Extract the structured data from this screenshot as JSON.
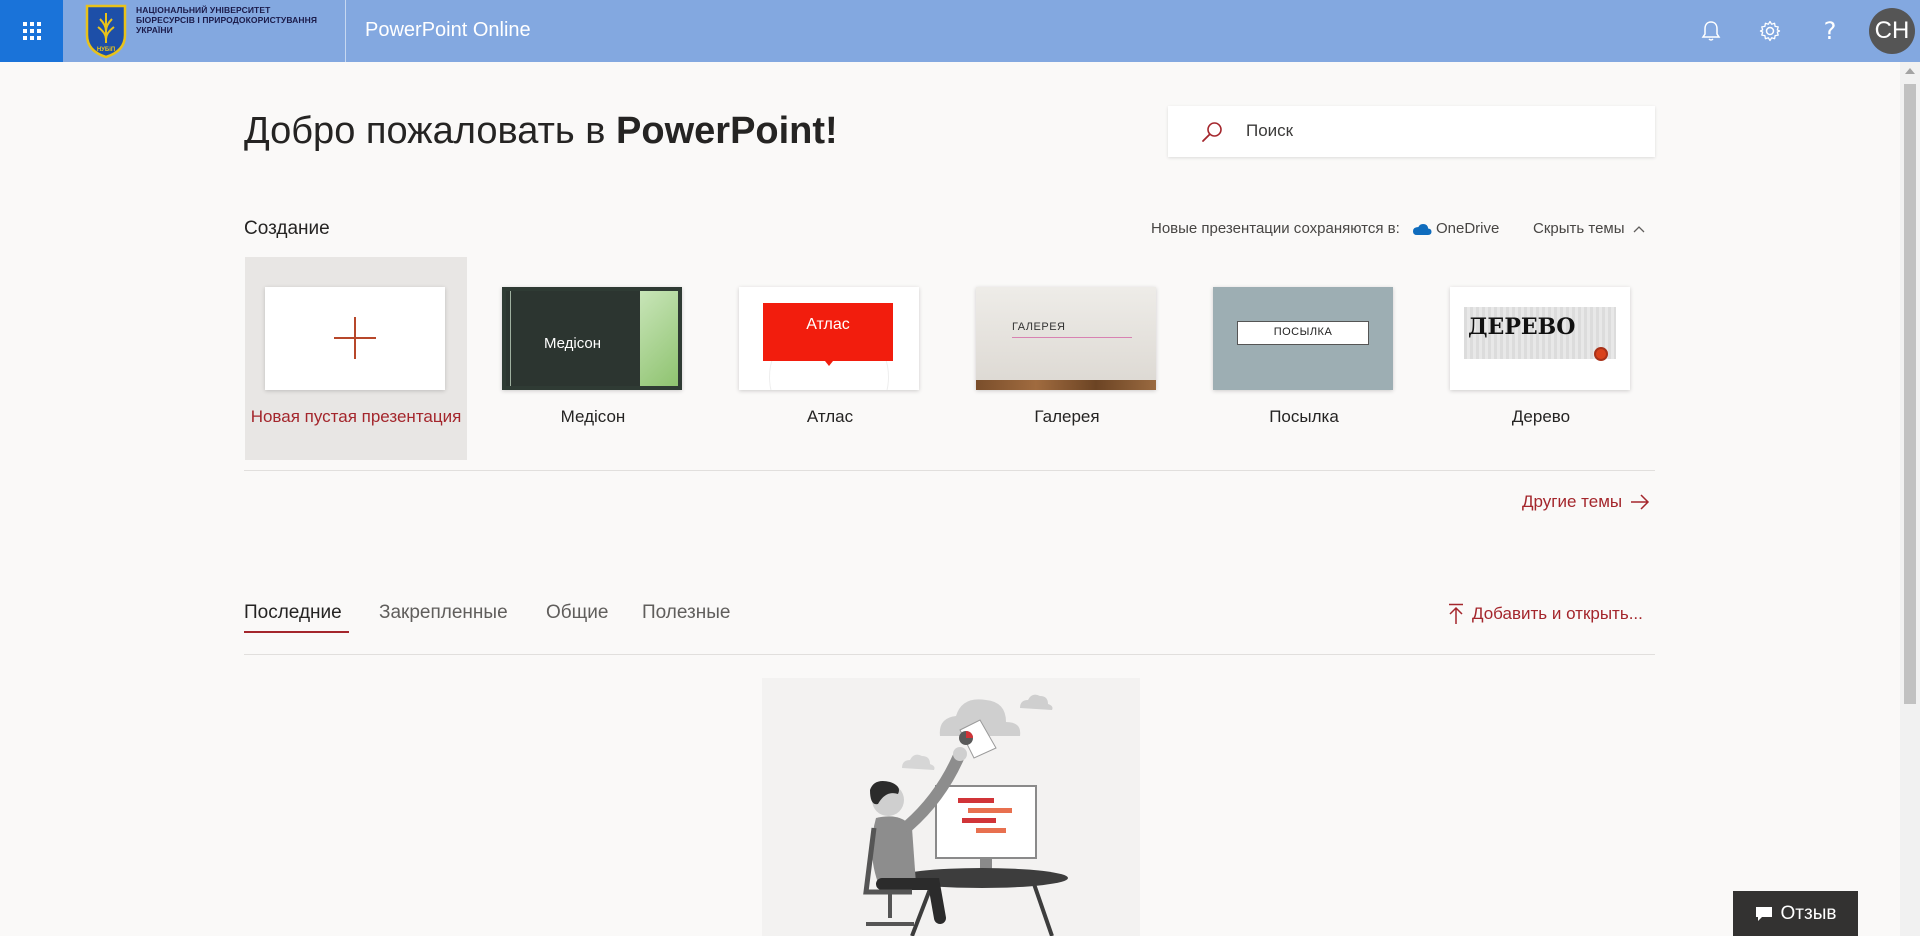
{
  "header": {
    "org_lines": [
      "НАЦІОНАЛЬНИЙ УНІВЕРСИТЕТ",
      "БІОРЕСУРСІВ І ПРИРОДОКОРИСТУВАННЯ",
      "УКРАЇНИ"
    ],
    "logo_text": "НУБіП",
    "app_title": "PowerPoint Online",
    "avatar_initials": "CH",
    "help_glyph": "?"
  },
  "main": {
    "welcome_prefix": "Добро пожаловать в ",
    "welcome_brand": "PowerPoint!",
    "search_placeholder": "Поиск"
  },
  "create": {
    "title": "Создание",
    "save_note": "Новые презентации сохраняются в:",
    "save_location": "OneDrive",
    "hide_themes": "Скрыть темы",
    "templates": [
      {
        "label": "Новая пустая презентация",
        "thumb_text": ""
      },
      {
        "label": "Медісон",
        "thumb_text": "Медісон"
      },
      {
        "label": "Атлас",
        "thumb_text": "Атлас"
      },
      {
        "label": "Галерея",
        "thumb_text": "ГАЛЕРЕЯ"
      },
      {
        "label": "Посылка",
        "thumb_text": "ПОСЫЛКА"
      },
      {
        "label": "Дерево",
        "thumb_text": "ДЕРЕВО"
      }
    ],
    "more_themes": "Другие темы"
  },
  "files": {
    "tabs": [
      "Последние",
      "Закрепленные",
      "Общие",
      "Полезные"
    ],
    "active_tab": "Последние",
    "upload_open": "Добавить и открыть..."
  },
  "feedback": {
    "label": "Отзыв"
  },
  "colors": {
    "header_bg": "#83a8e0",
    "waffle_bg": "#1a73d9",
    "accent": "#a4262c",
    "onedrive": "#0f6cbd"
  },
  "icons": [
    "app-launcher-icon",
    "bell-icon",
    "gear-icon",
    "help-icon",
    "search-icon",
    "onedrive-cloud-icon",
    "chevron-up-icon",
    "arrow-right-icon",
    "upload-icon",
    "feedback-chat-icon"
  ]
}
